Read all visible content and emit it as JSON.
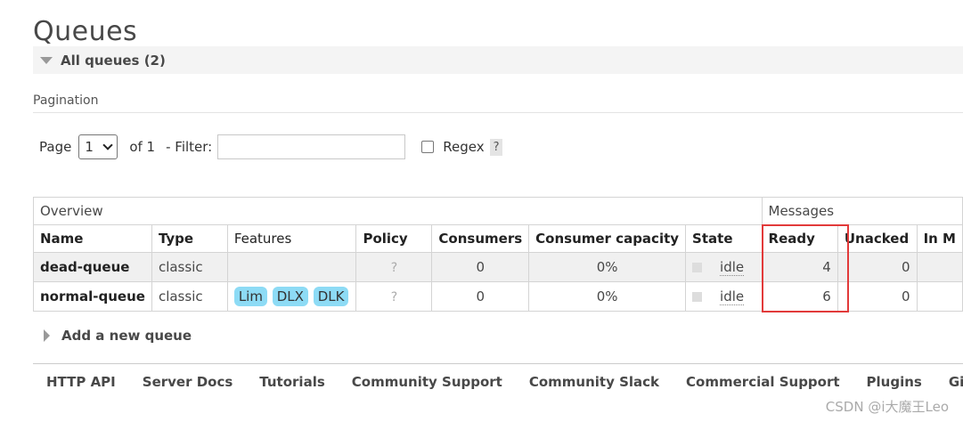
{
  "page": {
    "title": "Queues"
  },
  "section": {
    "label": "All queues (2)"
  },
  "pagination": {
    "label": "Pagination",
    "page_label": "Page",
    "page_value": "1",
    "of_label": "of 1",
    "filter_label": "- Filter:",
    "filter_value": "",
    "regex_label": "Regex",
    "help": "?"
  },
  "table": {
    "group_overview": "Overview",
    "group_messages": "Messages",
    "columns": [
      "Name",
      "Type",
      "Features",
      "Policy",
      "Consumers",
      "Consumer capacity",
      "State",
      "Ready",
      "Unacked",
      "In M"
    ],
    "rows": [
      {
        "name": "dead-queue",
        "type": "classic",
        "features": [],
        "policy": "?",
        "consumers": "0",
        "capacity": "0%",
        "state": "idle",
        "ready": "4",
        "unacked": "0"
      },
      {
        "name": "normal-queue",
        "type": "classic",
        "features": [
          "Lim",
          "DLX",
          "DLK"
        ],
        "policy": "?",
        "consumers": "0",
        "capacity": "0%",
        "state": "idle",
        "ready": "6",
        "unacked": "0"
      }
    ]
  },
  "add_queue": {
    "label": "Add a new queue"
  },
  "footer": {
    "links": [
      "HTTP API",
      "Server Docs",
      "Tutorials",
      "Community Support",
      "Community Slack",
      "Commercial Support",
      "Plugins",
      "Gi"
    ]
  },
  "watermark": "CSDN @i大魔王Leo",
  "colors": {
    "feature_pill": "#8ddbf5",
    "highlight": "#e23a3a",
    "header_bg": "#f4f4f4"
  }
}
